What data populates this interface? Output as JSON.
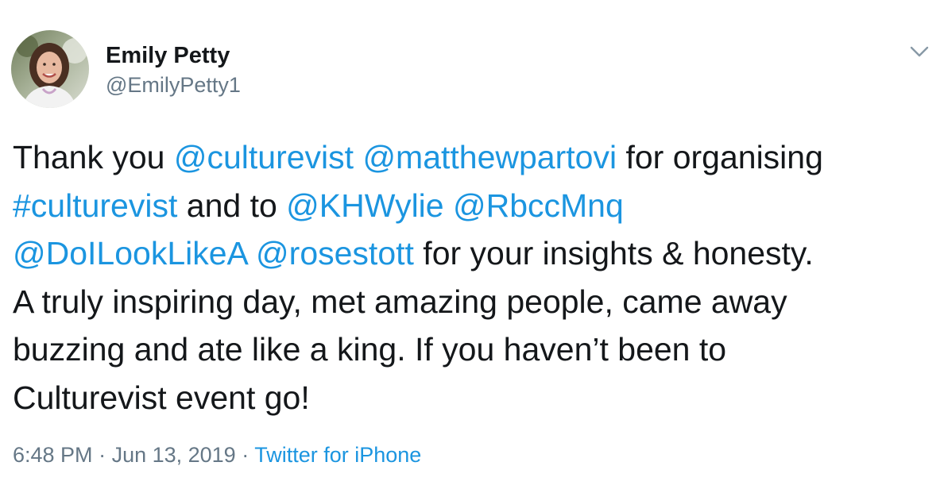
{
  "author": {
    "name": "Emily Petty",
    "handle": "@EmilyPetty1",
    "avatar_icon": "profile-photo"
  },
  "menu_icon": "chevron-down-icon",
  "tweet": {
    "lines": [
      [
        {
          "text": "Thank you ",
          "type": "text"
        },
        {
          "text": "@culturevist",
          "type": "mention"
        },
        {
          "text": " ",
          "type": "text"
        },
        {
          "text": "@matthewpartovi",
          "type": "mention"
        },
        {
          "text": " for organising",
          "type": "text"
        }
      ],
      [
        {
          "text": "#culturevist",
          "type": "hashtag"
        },
        {
          "text": " and to ",
          "type": "text"
        },
        {
          "text": "@KHWylie",
          "type": "mention"
        },
        {
          "text": " ",
          "type": "text"
        },
        {
          "text": "@RbccMnq",
          "type": "mention"
        }
      ],
      [
        {
          "text": "@DoILookLikeA",
          "type": "mention"
        },
        {
          "text": " ",
          "type": "text"
        },
        {
          "text": "@rosestott",
          "type": "mention"
        },
        {
          "text": " for your insights & honesty.",
          "type": "text"
        }
      ],
      [
        {
          "text": "A truly inspiring day, met amazing people, came away",
          "type": "text"
        }
      ],
      [
        {
          "text": "buzzing and ate like a king. If you haven’t been to",
          "type": "text"
        }
      ],
      [
        {
          "text": "Culturevist event go!",
          "type": "text"
        }
      ]
    ]
  },
  "meta": {
    "time": "6:48 PM",
    "separator": " · ",
    "date": "Jun 13, 2019",
    "source": "Twitter for iPhone"
  },
  "colors": {
    "text": "#14171a",
    "secondary": "#657786",
    "link": "#1b95e0",
    "background": "#ffffff"
  }
}
